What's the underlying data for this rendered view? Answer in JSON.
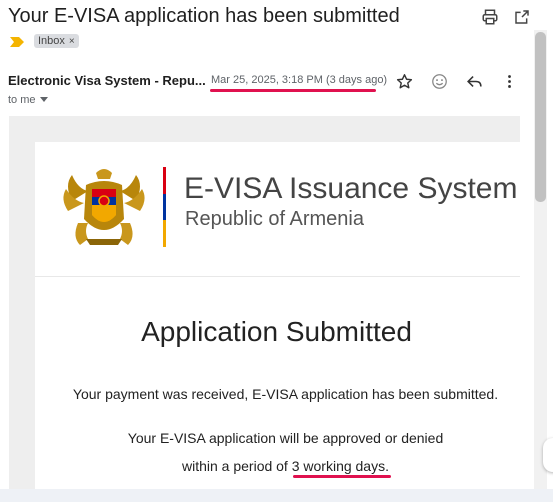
{
  "email": {
    "subject": "Your E-VISA application has been submitted",
    "label": "Inbox",
    "label_close": "×",
    "sender": "Electronic Visa System - Repu...",
    "date": "Mar 25, 2025, 3:18 PM (3 days ago)",
    "recipient": "to me"
  },
  "icons": {
    "print": "print-icon",
    "open_new": "open-in-new-window-icon",
    "star": "star-icon",
    "emoji": "emoji-react-icon",
    "reply": "reply-icon",
    "more": "more-vert-icon",
    "importance": "importance-marker-icon"
  },
  "body": {
    "system_title": "E-VISA Issuance System",
    "system_subtitle": "Republic of Armenia",
    "heading": "Application Submitted",
    "payment_line": "Your payment was received, E-VISA application has been submitted.",
    "approval_line1": "Your E-VISA application will be approved or denied",
    "approval_prefix": "within a period of ",
    "approval_days": "3 working days",
    "approval_suffix": "."
  },
  "colors": {
    "highlight_underline": "#e0114f",
    "flag_red": "#d90012",
    "flag_blue": "#0033a0",
    "flag_orange": "#f2a800",
    "importance_yellow": "#f4b400"
  }
}
